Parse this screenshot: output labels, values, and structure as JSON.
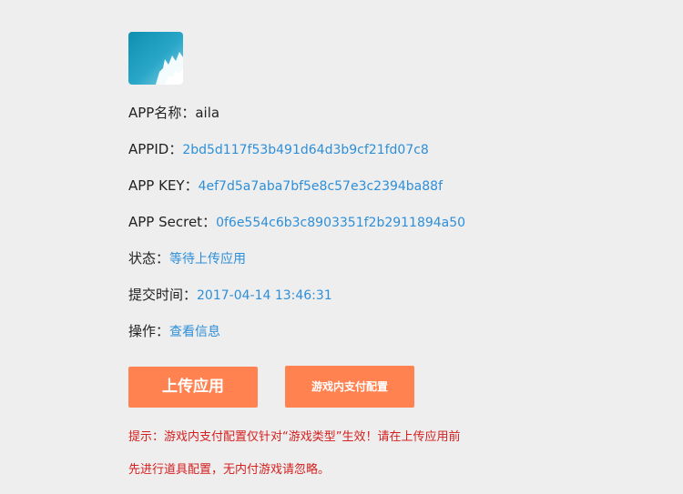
{
  "app": {
    "name_label": "APP名称：",
    "name_value": "aila",
    "id_label": "APPID：",
    "id_value": "2bd5d117f53b491d64d3b9cf21fd07c8",
    "key_label": "APP KEY：",
    "key_value": "4ef7d5a7aba7bf5e8c57e3c2394ba88f",
    "secret_label": "APP Secret：",
    "secret_value": "0f6e554c6b3c8903351f2b2911894a50",
    "status_label": "状态：",
    "status_value": "等待上传应用",
    "time_label": "提交时间：",
    "time_value": "2017-04-14 13:46:31",
    "action_label": "操作：",
    "action_link": "查看信息"
  },
  "buttons": {
    "upload_label": "上传应用",
    "iap_label": "游戏内支付配置"
  },
  "notice": {
    "line1": "提示：游戏内支付配置仅针对“游戏类型”生效！请在上传应用前",
    "line2": "先进行道具配置，无内付游戏请忽略。"
  },
  "colors": {
    "accent_button": "#ff8250",
    "link_blue": "#2e8fd8",
    "notice_red": "#d42020",
    "background": "#eeeeee"
  },
  "icons": {
    "app_icon": "app-thumbnail-icon"
  }
}
